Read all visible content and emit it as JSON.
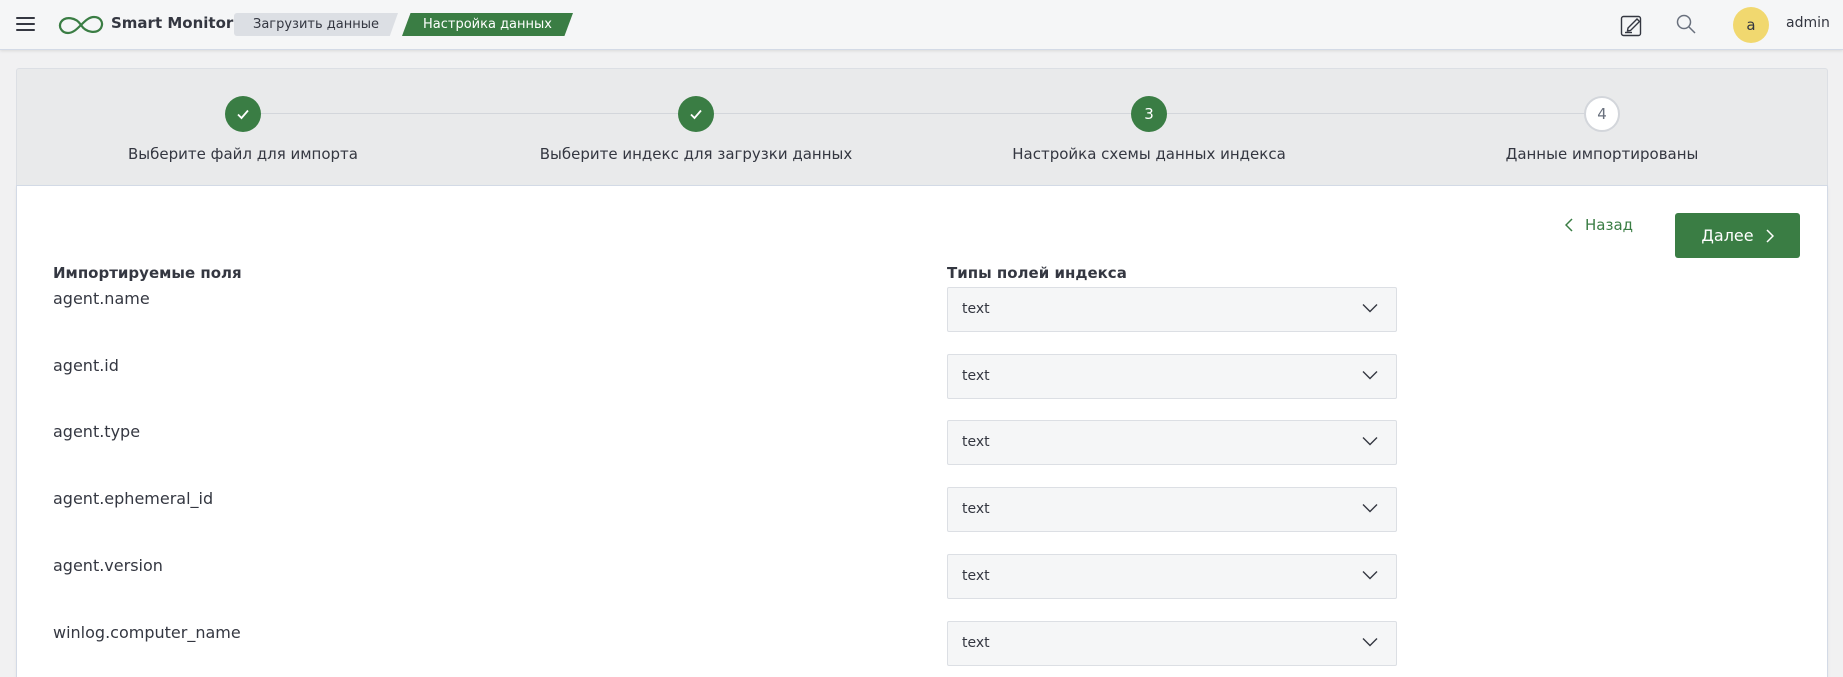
{
  "header": {
    "brand": "Smart Monitor",
    "breadcrumbs": [
      "Загрузить данные",
      "Настройка данных"
    ],
    "avatar_letter": "a",
    "username": "admin",
    "colors": {
      "accent": "#3a7d44",
      "avatar": "#f1d86f"
    }
  },
  "steps": [
    {
      "number": "1",
      "title": "Выберите файл для импорта",
      "status": "complete"
    },
    {
      "number": "2",
      "title": "Выберите индекс для загрузки данных",
      "status": "complete"
    },
    {
      "number": "3",
      "title": "Настройка схемы данных индекса",
      "status": "current"
    },
    {
      "number": "4",
      "title": "Данные импортированы",
      "status": "incomplete"
    }
  ],
  "actions": {
    "back_label": "Назад",
    "next_label": "Далее"
  },
  "columns": {
    "imported_fields": "Импортируемые поля",
    "index_field_types": "Типы полей индекса"
  },
  "fields": [
    {
      "name": "agent.name",
      "type": "text"
    },
    {
      "name": "agent.id",
      "type": "text"
    },
    {
      "name": "agent.type",
      "type": "text"
    },
    {
      "name": "agent.ephemeral_id",
      "type": "text"
    },
    {
      "name": "agent.version",
      "type": "text"
    },
    {
      "name": "winlog.computer_name",
      "type": "text"
    }
  ]
}
